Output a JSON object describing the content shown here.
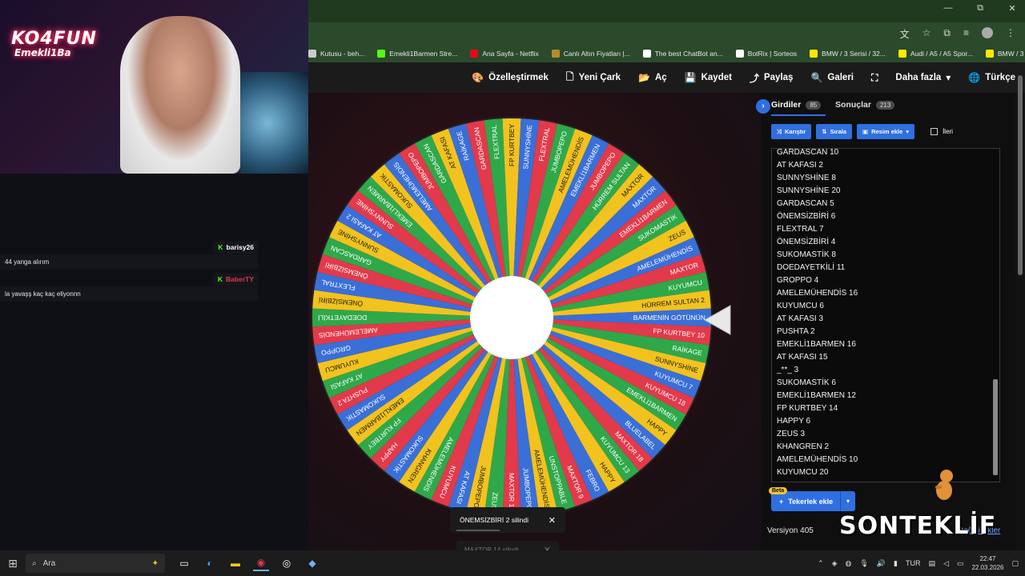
{
  "window": {
    "buttons": [
      "—",
      "⧉",
      "✕"
    ]
  },
  "bookmarks": [
    {
      "label": "Kutusu - beh...",
      "icon": "page-icon",
      "color": "#cccccc"
    },
    {
      "label": "Emekli1Barmen Stre...",
      "icon": "kick-icon",
      "color": "#53fc18"
    },
    {
      "label": "Ana Sayfa - Netflix",
      "icon": "netflix-icon",
      "color": "#e50914"
    },
    {
      "label": "Canlı Altın Fiyatları |...",
      "icon": "gold-icon",
      "color": "#b58b2a"
    },
    {
      "label": "The best ChatBot an...",
      "icon": "chatbot-icon",
      "color": "#ffffff"
    },
    {
      "label": "BotRix | Sorteos",
      "icon": "botrix-icon",
      "color": "#ffffff"
    },
    {
      "label": "BMW / 3 Serisi / 32...",
      "icon": "sahibinden-icon",
      "color": "#ffe800"
    },
    {
      "label": "Audi / A5 / A5 Spor...",
      "icon": "sahibinden-icon",
      "color": "#ffe800"
    },
    {
      "label": "BMW / 3 Serisi / 32...",
      "icon": "sahibinden-icon",
      "color": "#ffe800"
    }
  ],
  "toolbar": {
    "customize": "Özelleştirmek",
    "new_wheel": "Yeni Çark",
    "open": "Aç",
    "save": "Kaydet",
    "share": "Paylaş",
    "gallery": "Galeri",
    "more": "Daha fazla",
    "language": "Türkçe"
  },
  "stream": {
    "logo_line1": "KO4FUN",
    "logo_line2": "Emekli1Ba",
    "chat": [
      {
        "user": "barisy26",
        "message": "44 yanga alırım"
      },
      {
        "user": "BaberTY",
        "message": "la yavaşş kaç kaç eliyonnn"
      }
    ]
  },
  "panel": {
    "tab_inputs": "Girdiler",
    "inputs_count": "85",
    "tab_results": "Sonuçlar",
    "results_count": "213",
    "shuffle": "Karıştır",
    "sort": "Sırala",
    "add_image": "Resim ekle",
    "advanced": "İleri",
    "entries": [
      "GARDASCAN 10",
      "AT KAFASI 2",
      "SUNNYSHİNE 8",
      "SUNNYSHİNE 20",
      "GARDASCAN 5",
      "ÖNEMSİZBİRİ 6",
      "FLEXTRAL 7",
      "ÖNEMSİZBİRİ 4",
      "SUKOMASTİK 8",
      "DOEDAYETKİLİ 11",
      "GROPPO 4",
      "AMELEMÜHENDİS 16",
      "KUYUMCU 6",
      "AT KAFASI 3",
      "PUSHTA 2",
      "EMEKLİ1BARMEN 16",
      "AT KAFASI 15",
      "_**_ 3",
      "SUKOMASTİK 6",
      "EMEKLİ1BARMEN 12",
      "FP KURTBEY 14",
      "HAPPY 6",
      "ZEUS 3",
      "KHANGREN 2",
      "AMELEMÜHENDİS 10",
      "KUYUMCU 20"
    ],
    "beta": "Beta",
    "add_wheels": "Tekerlek ekle",
    "version": "Versiyon 405",
    "changes": "Değişiklikler",
    "overlay_brand": "SONTEKLİF"
  },
  "wheel": {
    "colors": [
      "#3a6fd8",
      "#e23a4a",
      "#2fa84a",
      "#f2c21e"
    ],
    "labels": [
      "BARMENİN GÖTÜNÜN",
      "FP KURTBEY 10",
      "RAİKAGE",
      "SUNNYSHİNE",
      "KUYUMCU 7",
      "KUYUMCU 18",
      "EMEKLİ1BARMEN",
      "HAPPY",
      "BLUELABEL",
      "MAXTOR 18",
      "KUYUMCU 13",
      "HAPPY",
      "FEBRO",
      "MAXTOR 9",
      "UNSTOPPABLE",
      "AMELEMÜHENDİS",
      "JUMBOPEPO",
      "MAXTOR 19",
      "ZEUS",
      "JUMBOPEPO",
      "AT KAFASI",
      "KUYUMCU",
      "AMELEMÜHENDİS",
      "KHANGREN",
      "SUKOMASTİK",
      "HAPPY",
      "FP KURTBEY",
      "EMEKLİ1BARMEN",
      "SUKOMASTİK",
      "PUSHTA 2",
      "AT KAFASI",
      "KUYUMCU",
      "GROPPO",
      "AMELEMÜHENDİS",
      "DOEDAYETKİLİ",
      "ÖNEMSİZBİRİ",
      "FLEXTRAL",
      "ÖNEMSİZBİRİ",
      "GARDASCAN",
      "SUNNYSHİNE",
      "AT KAFASI 2",
      "SUNNYSHİNE",
      "EMEKLİ1BARMEN",
      "SUKOMASTİK",
      "AMELEMÜHENDİS",
      "JUMBOPEPO",
      "GARDASCAN",
      "AT KAFASI",
      "RAİKAGE",
      "GARDASCAN",
      "FLEXTRAL",
      "FP KURTBEY",
      "SUNNYSHİNE",
      "FLEXTRAL",
      "JUMBOPEPO",
      "AMELEMÜHENDİS",
      "EMEKLİ1BARMEN",
      "JUMBOPEPO",
      "HÜRREM SULTAN",
      "MAXTOR",
      "MAXTOR",
      "EMEKLİ1BARMEN",
      "SUKOMASTİK",
      "ZEUS",
      "AMELEMÜHENDİS",
      "MAXTOR",
      "KUYUMCU",
      "HÜRREM SULTAN 2"
    ]
  },
  "toasts": [
    {
      "text": "ÖNEMSİZBİRİ 2 silindi",
      "close": "✕"
    },
    {
      "text": "MAXTOR 14 silindi",
      "close": "✕"
    }
  ],
  "taskbar": {
    "search_placeholder": "Ara",
    "language": "TUR",
    "time": "22:47",
    "date": "22.03.2026"
  }
}
